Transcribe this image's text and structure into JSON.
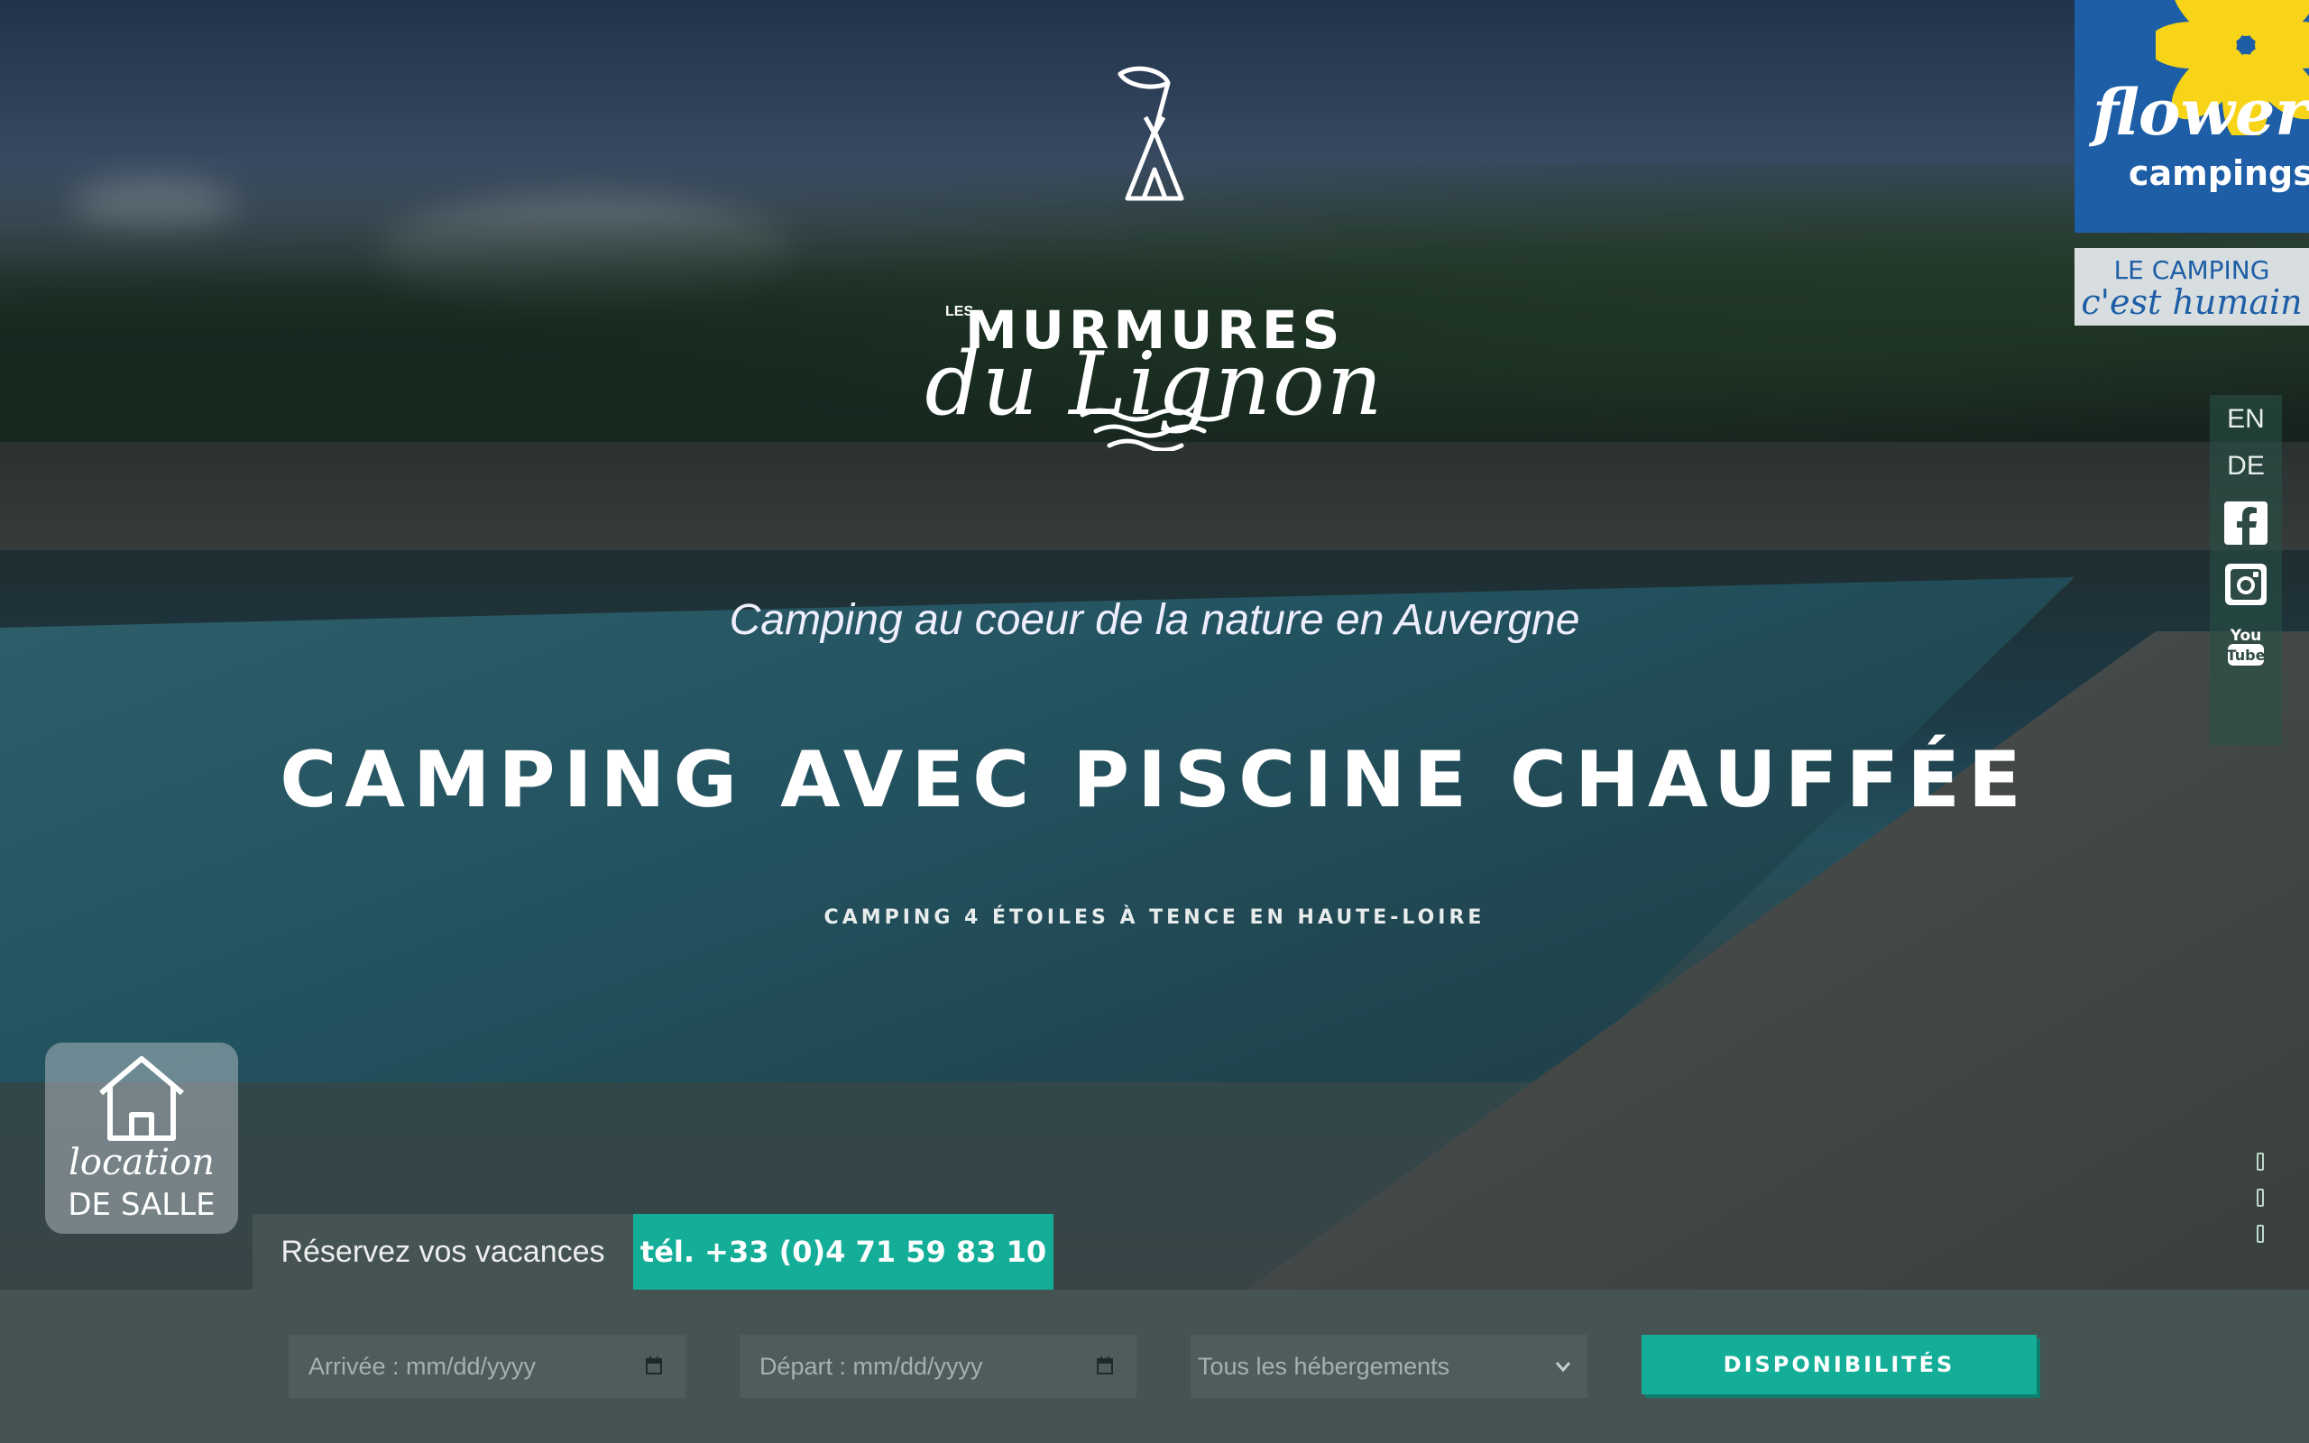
{
  "logo": {
    "les": "LES",
    "title": "MURMURES",
    "script": "du Lignon"
  },
  "hero": {
    "tagline": "Camping au coeur de la nature en Auvergne",
    "headline": "CAMPING AVEC PISCINE CHAUFFÉE",
    "subline": "CAMPING 4 ÉTOILES À TENCE EN HAUTE-LOIRE"
  },
  "badge": {
    "brand": "flower",
    "brand_sub": "campings",
    "slogan_line1": "LE CAMPING",
    "slogan_line2": "c'est humain"
  },
  "languages": [
    "EN",
    "DE"
  ],
  "socials": [
    "facebook-icon",
    "instagram-icon",
    "youtube-icon"
  ],
  "salle": {
    "line1": "location",
    "line2": "DE SALLE"
  },
  "booking": {
    "tab_book": "Réservez vos vacances",
    "tab_phone": "tél. +33 (0)4 71 59 83 10",
    "arrival": "Arrivée : mm/dd/yyyy",
    "departure": "Départ : mm/dd/yyyy",
    "accommodation": "Tous les hébergements",
    "submit": "DISPONIBILITÉS"
  },
  "colors": {
    "accent": "#14ae98",
    "bar": "#455453",
    "flower_blue": "#1d5ea6",
    "flower_yellow": "#f7d418"
  }
}
